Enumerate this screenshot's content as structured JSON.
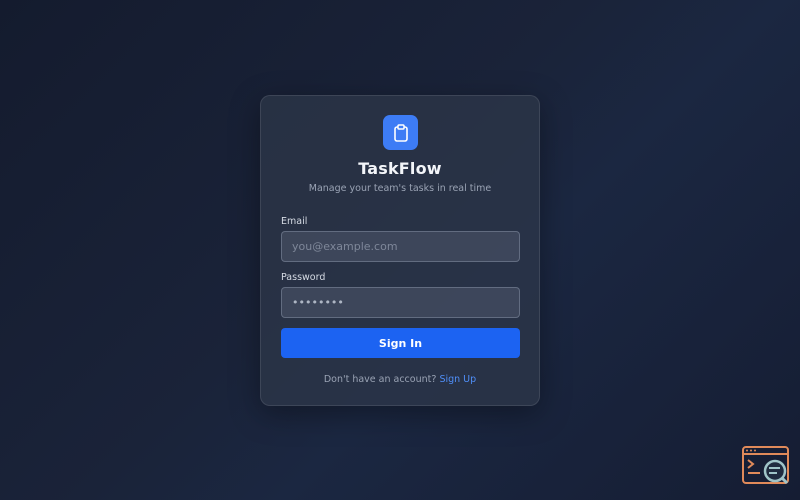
{
  "app": {
    "title": "TaskFlow",
    "subtitle": "Manage your team's tasks in real time",
    "logo_icon": "clipboard-icon",
    "accent_color": "#3d7cf5"
  },
  "form": {
    "email_label": "Email",
    "email_placeholder": "you@example.com",
    "email_value": "",
    "password_label": "Password",
    "password_value": "password",
    "submit_label": "Sign In",
    "button_color": "#1c63f2"
  },
  "footer": {
    "prompt": "Don't have an account?",
    "signup_label": "Sign Up",
    "link_color": "#4f8ef7"
  },
  "corner_widget": {
    "icon": "terminal-search-icon"
  }
}
